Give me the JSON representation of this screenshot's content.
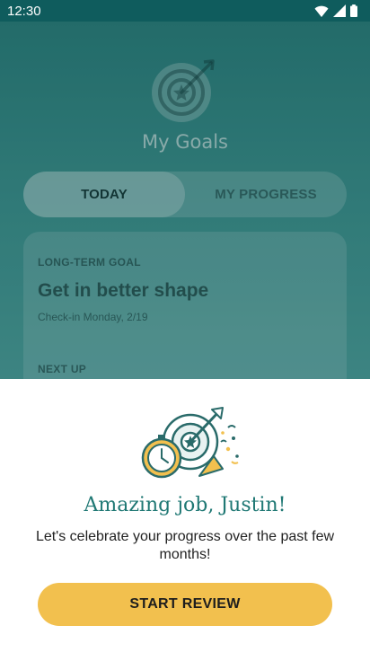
{
  "status_bar": {
    "time": "12:30",
    "icons": [
      "wifi-icon",
      "cellular-signal-icon",
      "battery-icon"
    ]
  },
  "header": {
    "logo_icon": "target-arrow-icon",
    "title": "My Goals"
  },
  "tabs": [
    {
      "label": "TODAY",
      "selected": true
    },
    {
      "label": "MY PROGRESS",
      "selected": false
    }
  ],
  "goal_card": {
    "section_label": "LONG-TERM GOAL",
    "goal_title": "Get in better shape",
    "checkin_text": "Check-in Monday, 2/19",
    "next_label": "NEXT UP"
  },
  "sheet": {
    "illustration_icon": "celebration-target-stopwatch-icon",
    "heading": "Amazing job, Justin!",
    "message": "Let's celebrate your progress over the past few months!",
    "button_label": "START REVIEW"
  },
  "colors": {
    "teal": "#2a807e",
    "heading_teal": "#1f7874",
    "button_yellow": "#f2c04e"
  }
}
